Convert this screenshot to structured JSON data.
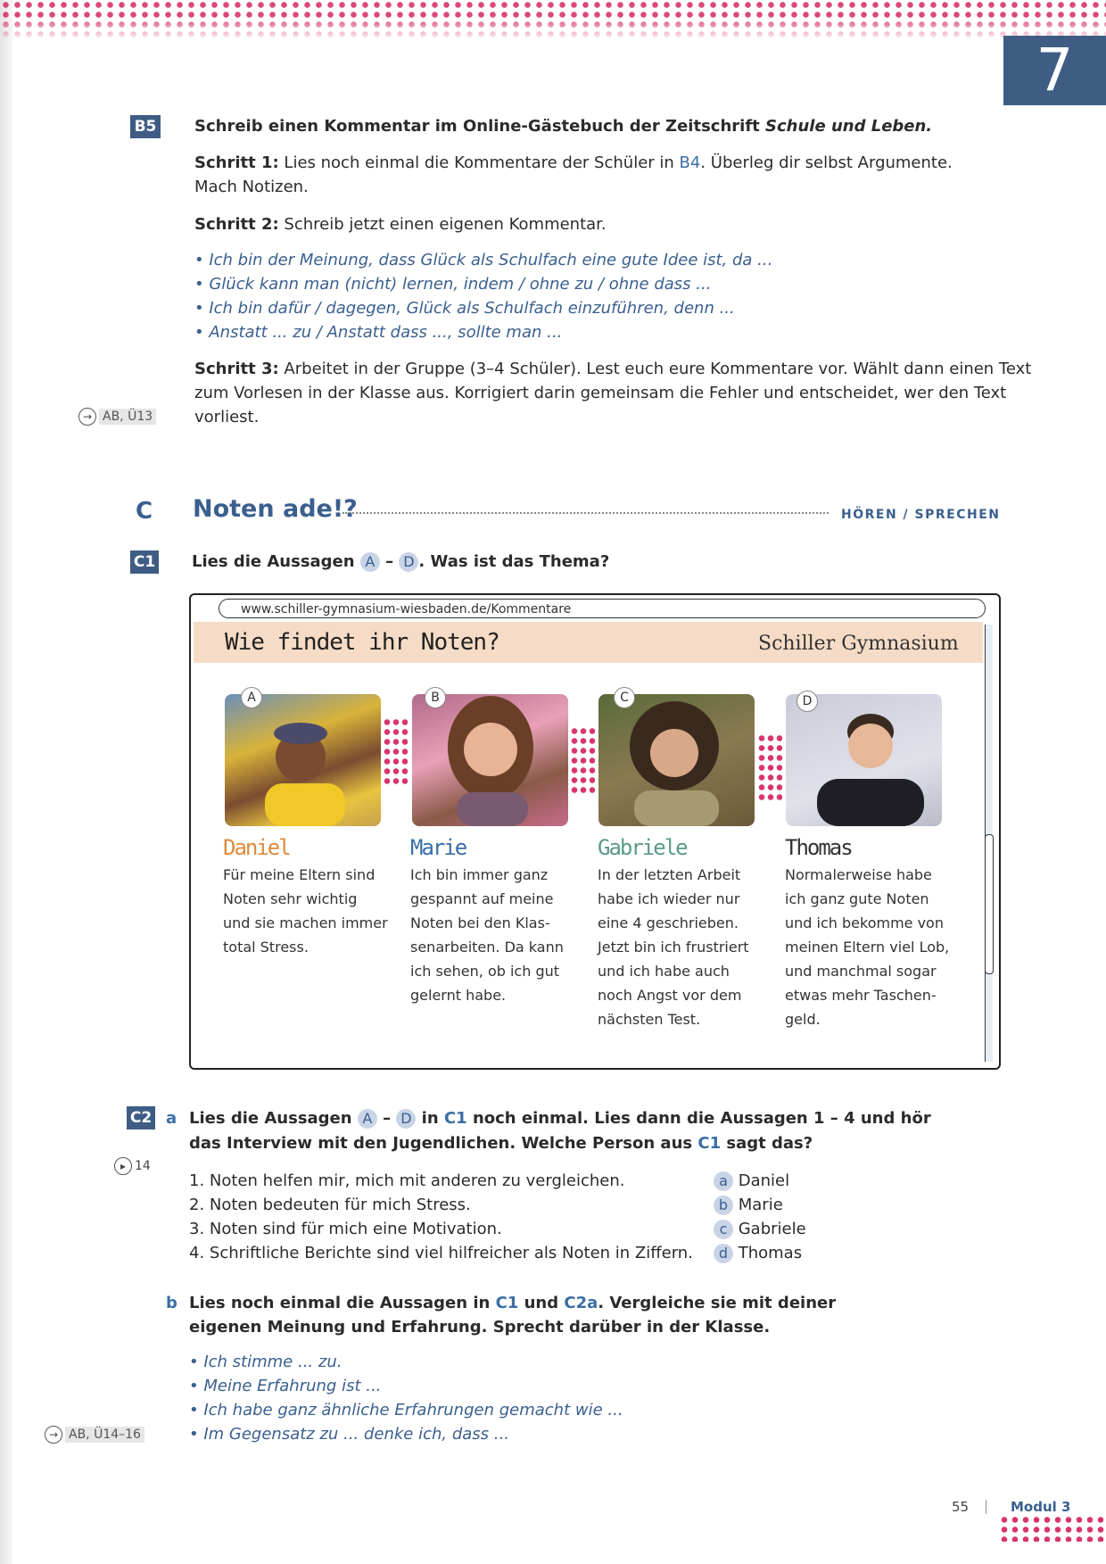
{
  "chapter_number": "7",
  "b5": {
    "tag": "B5",
    "instruction_plain": "Schreib einen Kommentar im Online-Gästebuch der Zeitschrift ",
    "instruction_italic": "Schule und Leben.",
    "step1_label": "Schritt 1:",
    "step1_text_a": " Lies noch einmal die Kommentare der Schüler in ",
    "step1_ref": "B4",
    "step1_text_b": ". Überleg dir selbst Argumente.",
    "step1_text_c": "Mach Notizen.",
    "step2_label": "Schritt 2:",
    "step2_text": " Schreib jetzt einen eigenen Kommentar.",
    "bullets": [
      "Ich bin der Meinung, dass Glück als Schulfach eine gute Idee ist, da ...",
      "Glück kann man (nicht) lernen, indem / ohne zu / ohne dass ...",
      "Ich bin dafür / dagegen, Glück als Schulfach einzuführen, denn ...",
      "Anstatt ... zu / Anstatt dass ..., sollte man ..."
    ],
    "step3_label": "Schritt 3:",
    "step3_line1": " Arbeitet in der Gruppe (3–4 Schüler). Lest euch eure Kommentare vor. Wählt dann einen Text",
    "step3_line2": "zum Vorlesen in der Klasse aus. Korrigiert darin gemeinsam die Fehler und entscheidet, wer den Text",
    "step3_line3": "vorliest.",
    "ab_ref": "AB, Ü13"
  },
  "section_c": {
    "letter": "C",
    "title": "Noten ade!?",
    "skills": "HÖREN / SPRECHEN"
  },
  "c1": {
    "tag": "C1",
    "text_a": "Lies die Aussagen ",
    "from": "A",
    "dash": " – ",
    "to": "D",
    "text_b": ". Was ist das Thema?"
  },
  "website": {
    "url": "www.schiller-gymnasium-wiesbaden.de/Kommentare",
    "title": "Wie findet ihr Noten?",
    "school": "Schiller Gymnasium",
    "people": [
      {
        "letter": "A",
        "name": "Daniel",
        "name_color": "#e08a3c",
        "lines": [
          "Für meine Eltern sind",
          "Noten sehr wichtig",
          "und sie machen immer",
          "total Stress."
        ]
      },
      {
        "letter": "B",
        "name": "Marie",
        "name_color": "#3a6ea5",
        "lines": [
          "Ich bin immer ganz",
          "gespannt auf meine",
          "Noten bei den Klas-",
          "senarbeiten. Da kann",
          "ich sehen, ob ich gut",
          "gelernt habe."
        ]
      },
      {
        "letter": "C",
        "name": "Gabriele",
        "name_color": "#5a9a8a",
        "lines": [
          "In der letzten Arbeit",
          "habe ich wieder nur",
          "eine 4 geschrieben.",
          "Jetzt bin ich frustriert",
          "und ich habe auch",
          "noch Angst vor dem",
          "nächsten Test."
        ]
      },
      {
        "letter": "D",
        "name": "Thomas",
        "name_color": "#333333",
        "lines": [
          "Normalerweise habe",
          "ich ganz gute Noten",
          "und ich bekomme von",
          "meinen Eltern viel Lob,",
          "und manchmal sogar",
          "etwas mehr Taschen-",
          "geld."
        ]
      }
    ]
  },
  "c2": {
    "tag": "C2",
    "a_label": "a",
    "a_text_1": "Lies die Aussagen ",
    "a_from": "A",
    "a_dash": " – ",
    "a_to": "D",
    "a_text_2": " in ",
    "a_ref": "C1",
    "a_text_3": " noch einmal. Lies dann die Aussagen 1 – 4 und hör",
    "a_line2_1": "das Interview mit den Jugendlichen. Welche Person aus ",
    "a_line2_ref": "C1",
    "a_line2_2": " sagt das?",
    "audio": "14",
    "statements": [
      "1.  Noten helfen mir, mich mit anderen zu vergleichen.",
      "2.  Noten bedeuten für mich Stress.",
      "3.  Noten sind für mich eine Motivation.",
      "4.  Schriftliche Berichte sind viel hilfreicher als Noten in Ziffern."
    ],
    "options": [
      {
        "key": "a",
        "name": "Daniel"
      },
      {
        "key": "b",
        "name": "Marie"
      },
      {
        "key": "c",
        "name": "Gabriele"
      },
      {
        "key": "d",
        "name": "Thomas"
      }
    ],
    "b_label": "b",
    "b_text_1": "Lies noch einmal die Aussagen in ",
    "b_ref1": "C1",
    "b_and": " und ",
    "b_ref2": "C2a",
    "b_text_2": ". Vergleiche sie mit deiner",
    "b_line2": "eigenen Meinung und Erfahrung. Sprecht darüber in der Klasse.",
    "b_bullets": [
      "Ich stimme ... zu.",
      "Meine Erfahrung ist ...",
      "Ich habe ganz ähnliche Erfahrungen gemacht wie ...",
      "Im Gegensatz zu ... denke ich, dass ..."
    ],
    "ab_ref": "AB, Ü14–16"
  },
  "footer": {
    "page": "55",
    "sep": "|",
    "modul": "Modul 3"
  }
}
